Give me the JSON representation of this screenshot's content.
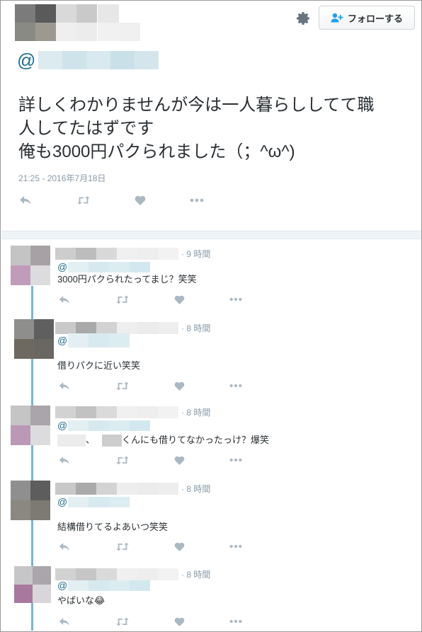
{
  "header": {
    "follow_label": "フォローする"
  },
  "main_tweet": {
    "handle_prefix": "@",
    "text_lines": [
      "詳しくわかりませんが今は一人暮らししてて職",
      "人してたはずです",
      "俺も3000円パクられました（；^ω^)"
    ],
    "timestamp": "21:25 - 2016年7月18日"
  },
  "replies": [
    {
      "time": "· 9 時間",
      "handle_prefix": "@",
      "text": "3000円パクられたってまじ？笑笑"
    },
    {
      "time": "· 8 時間",
      "handle_prefix": "@",
      "text": "借りパクに近い笑笑"
    },
    {
      "time": "· 8 時間",
      "handle_prefix": "@",
      "text_sep": "、",
      "text_rest": "くんにも借りてなかったっけ？爆笑"
    },
    {
      "time": "· 8 時間",
      "handle_prefix": "@",
      "text": "結構借りてるよあいつ笑笑"
    },
    {
      "time": "· 8 時間",
      "handle_prefix": "@",
      "text": "やばいな😂"
    }
  ],
  "icons": {
    "gear": "gear-icon",
    "follow": "add-user-icon",
    "reply": "reply-icon",
    "retweet": "retweet-icon",
    "like": "heart-icon",
    "more": "more-icon"
  },
  "colors": {
    "link": "#1d6d8f",
    "meta": "#8899a6",
    "thread_line": "#77b8cf",
    "action_icon": "#aab8c2"
  }
}
